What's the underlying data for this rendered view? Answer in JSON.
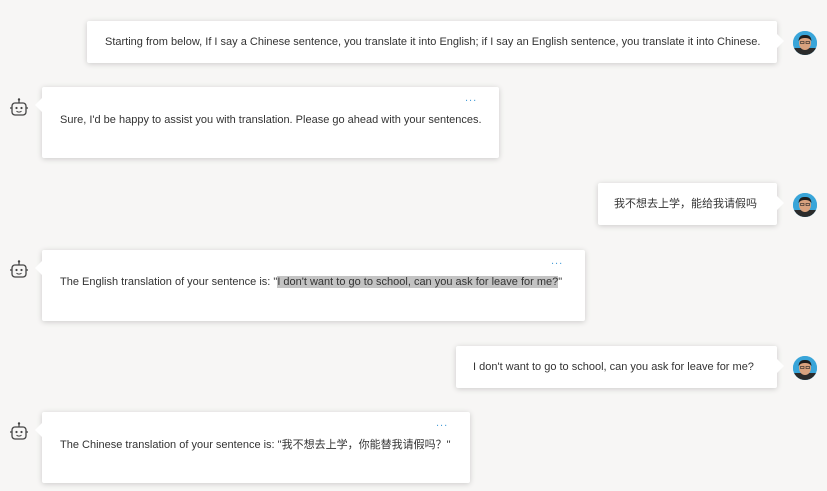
{
  "messages": [
    {
      "role": "user",
      "text": "Starting from below, If I say a Chinese sentence, you translate it into English; if I say an English sentence, you translate it into Chinese."
    },
    {
      "role": "bot",
      "text": "Sure, I'd be happy to assist you with translation. Please go ahead with your sentences.",
      "more": "..."
    },
    {
      "role": "user",
      "text": "我不想去上学，能给我请假吗"
    },
    {
      "role": "bot",
      "text_before": "The English translation of your sentence is: \"",
      "text_highlight": "I don't want to go to school, can you ask for leave for me?",
      "text_after": "\"",
      "more": "..."
    },
    {
      "role": "user",
      "text": "I don't want to go to school, can you ask for leave for me?"
    },
    {
      "role": "bot",
      "text": "The Chinese translation of your sentence is: \"我不想去上学，你能替我请假吗？\"",
      "more": "..."
    }
  ],
  "colors": {
    "background": "#f7f6f5",
    "bubble": "#ffffff",
    "accent": "#4a9fd8",
    "highlight": "#c3c3c3",
    "avatar_bg": "#39a5d9"
  },
  "icons": {
    "user_avatar": "user-avatar",
    "bot_avatar": "robot-icon",
    "more": "more-dots-icon"
  }
}
